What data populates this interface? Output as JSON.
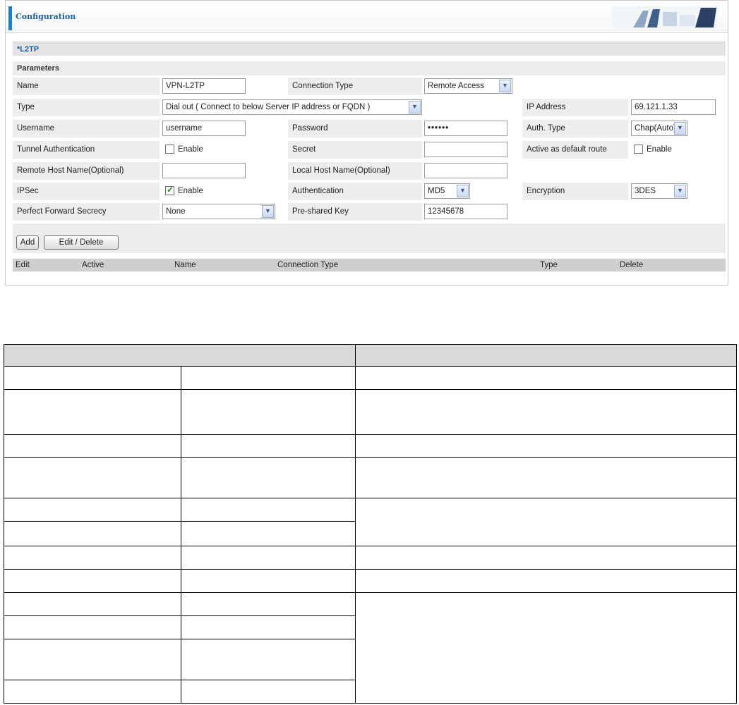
{
  "header": {
    "title": "Configuration"
  },
  "section": {
    "title": "*L2TP"
  },
  "parameters": {
    "title": "Parameters",
    "name": {
      "label": "Name",
      "value": "VPN-L2TP"
    },
    "connection_type": {
      "label": "Connection Type",
      "value": "Remote Access"
    },
    "type": {
      "label": "Type",
      "value": "Dial out ( Connect to below Server IP address or FQDN )"
    },
    "ip_address": {
      "label": "IP Address",
      "value": "69.121.1.33"
    },
    "username": {
      "label": "Username",
      "value": "username"
    },
    "password": {
      "label": "Password",
      "value": "••••••"
    },
    "auth_type": {
      "label": "Auth. Type",
      "value": "Chap(Auto)"
    },
    "tunnel_auth": {
      "label": "Tunnel Authentication",
      "option": "Enable"
    },
    "secret": {
      "label": "Secret",
      "value": ""
    },
    "default_route": {
      "label": "Active as default route",
      "option": "Enable"
    },
    "remote_host": {
      "label": "Remote Host Name(Optional)",
      "value": ""
    },
    "local_host": {
      "label": "Local Host Name(Optional)",
      "value": ""
    },
    "ipsec": {
      "label": "IPSec",
      "option": "Enable"
    },
    "authentication": {
      "label": "Authentication",
      "value": "MD5"
    },
    "encryption": {
      "label": "Encryption",
      "value": "3DES"
    },
    "pfs": {
      "label": "Perfect Forward Secrecy",
      "value": "None"
    },
    "psk": {
      "label": "Pre-shared Key",
      "value": "12345678"
    }
  },
  "buttons": {
    "add": "Add",
    "edit_delete": "Edit / Delete"
  },
  "list_columns": [
    "Edit",
    "Active",
    "Name",
    "Connection Type",
    "Type",
    "Delete"
  ]
}
